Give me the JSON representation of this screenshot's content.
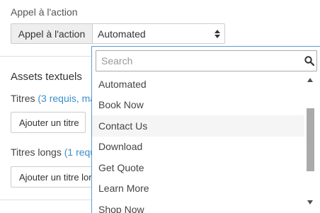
{
  "cta": {
    "section_label": "Appel à l'action",
    "addon_label": "Appel à l'action",
    "selected_value": "Automated"
  },
  "assets": {
    "heading": "Assets textuels",
    "titres_label": "Titres",
    "titres_hint": "(3 requis, ma",
    "add_title_button": "Ajouter un titre",
    "titres_longs_label": "Titres longs",
    "titres_longs_hint": "(1 requ",
    "add_long_title_button": "Ajouter un titre lon"
  },
  "dropdown": {
    "search_placeholder": "Search",
    "highlighted_option": "Contact Us",
    "options": [
      "Automated",
      "Book Now",
      "Contact Us",
      "Download",
      "Get Quote",
      "Learn More",
      "Shop Now"
    ]
  },
  "colors": {
    "accent": "#3a8fc9",
    "dropdown_border": "#5b9bd5",
    "highlight": "#f5f5f5",
    "scroll_thumb": "#aaaaaa"
  },
  "icons": {
    "select_arrows": "sort-arrows-icon",
    "search": "search-icon",
    "scroll_up": "triangle-up-icon",
    "scroll_down": "triangle-down-icon"
  }
}
